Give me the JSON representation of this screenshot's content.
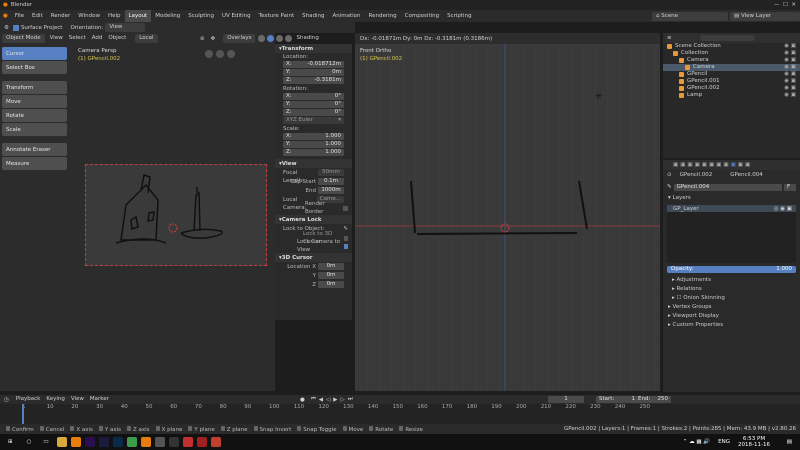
{
  "title": "Blender",
  "menu": [
    "File",
    "Edit",
    "Render",
    "Window",
    "Help"
  ],
  "workspaces": [
    "Layout",
    "Modeling",
    "Sculpting",
    "UV Editing",
    "Texture Paint",
    "Shading",
    "Animation",
    "Rendering",
    "Compositing",
    "Scripting"
  ],
  "active_workspace": "Layout",
  "scene_label": "Scene",
  "view_layer_label": "View Layer",
  "tool_header": {
    "surface_project": "Surface Project",
    "orientation_label": "Orientation:",
    "orientation_value": "View"
  },
  "viewport_header": {
    "mode": "Object Mode",
    "view": "View",
    "select": "Select",
    "add": "Add",
    "object": "Object",
    "local": "Local",
    "overlays": "Overlays",
    "shading": "Shading"
  },
  "tools": [
    "Cursor",
    "Select Box",
    "Transform",
    "Move",
    "Rotate",
    "Scale",
    "Annotate Eraser",
    "Measure"
  ],
  "cam_view": {
    "title": "Camera Persp",
    "subtitle": "(1) GPencil.002"
  },
  "ortho_view": {
    "title": "Front Ortho",
    "subtitle": "(1) GPencil.002",
    "header": "Dx: -0.01871m   Dy: 0m   Dz: -0.3181m (0.3186m)"
  },
  "npanel": {
    "transform": "Transform",
    "location_label": "Location:",
    "location": [
      {
        "k": "X:",
        "v": "-0.018712m"
      },
      {
        "k": "Y:",
        "v": "0m"
      },
      {
        "k": "Z:",
        "v": "-0.3181m"
      }
    ],
    "rotation_label": "Rotation:",
    "rotation": [
      {
        "k": "X:",
        "v": "0°"
      },
      {
        "k": "Y:",
        "v": "0°"
      },
      {
        "k": "Z:",
        "v": "0°"
      }
    ],
    "euler": "XYZ Euler",
    "scale_label": "Scale:",
    "scale": [
      {
        "k": "X:",
        "v": "1.000"
      },
      {
        "k": "Y:",
        "v": "1.000"
      },
      {
        "k": "Z:",
        "v": "1.000"
      }
    ],
    "view": "View",
    "focal_length_label": "Focal Length:",
    "focal_length": "50mm",
    "clip_start_label": "Clip Start",
    "clip_start": "0.1m",
    "end_label": "End",
    "end": "1000m",
    "local_camera_label": "Local Camera:",
    "local_camera": "Came...",
    "render_border": "Render Border",
    "camera_lock": "Camera Lock",
    "lock_to_object": "Lock to Object:",
    "lock_to_3d_cursor": "Lock to 3D Cursor",
    "lock_camera_to_view": "Lock Camera to View",
    "cursor_3d": "3D Cursor",
    "cursor_location_label": "Location X",
    "cursor_y": "Y",
    "cursor_z": "Z",
    "cursor_values": [
      "0m",
      "0m",
      "0m"
    ]
  },
  "outliner": {
    "items": [
      {
        "label": "Scene Collection",
        "indent": 0,
        "selected": false
      },
      {
        "label": "Collection",
        "indent": 1,
        "selected": false
      },
      {
        "label": "Camera",
        "indent": 2,
        "selected": false
      },
      {
        "label": "Camera",
        "indent": 3,
        "selected": true
      },
      {
        "label": "GPencil",
        "indent": 2,
        "selected": false
      },
      {
        "label": "GPencil.001",
        "indent": 2,
        "selected": false
      },
      {
        "label": "GPencil.002",
        "indent": 2,
        "selected": false
      },
      {
        "label": "Lamp",
        "indent": 2,
        "selected": false
      }
    ]
  },
  "props": {
    "object_a": "GPencil.002",
    "object_b": "GPencil.004",
    "data_name": "GPencil.004",
    "data_f": "F",
    "layers": "Layers",
    "layer_item": "GP_Layer",
    "opacity_label": "Opacity:",
    "opacity_value": "1.000",
    "opacity_fraction": 1.0,
    "sections": [
      "Adjustments",
      "Relations",
      "Onion Skinning",
      "Vertex Groups",
      "Viewport Display",
      "Custom Properties"
    ]
  },
  "timeline": {
    "playback": "Playback",
    "keying": "Keying",
    "view": "View",
    "marker": "Marker",
    "current_frame": "1",
    "start_label": "Start:",
    "start": "1",
    "end_label": "End:",
    "end": "250",
    "ticks": [
      "1",
      "10",
      "20",
      "30",
      "40",
      "50",
      "60",
      "70",
      "80",
      "90",
      "100",
      "110",
      "120",
      "130",
      "140",
      "150",
      "160",
      "170",
      "180",
      "190",
      "200",
      "210",
      "220",
      "230",
      "240",
      "250"
    ]
  },
  "status": {
    "items": [
      "Confirm",
      "Cancel",
      "X axis",
      "Y axis",
      "Z axis",
      "X plane",
      "Y plane",
      "Z plane",
      "Snap Invert",
      "Snap Toggle",
      "Move",
      "Rotate",
      "Resize"
    ],
    "right": "GPencil.002 | Layers:1 | Frames:1 | Strokes:2 | Points:285 | Mem: 43.9 MB | v2.80.26"
  },
  "taskbar": {
    "time": "6:53 PM",
    "date": "2018-11-16",
    "lang": "ENG"
  },
  "colors": {
    "accent": "#5680c2",
    "header_bg": "#2b2b2b"
  }
}
